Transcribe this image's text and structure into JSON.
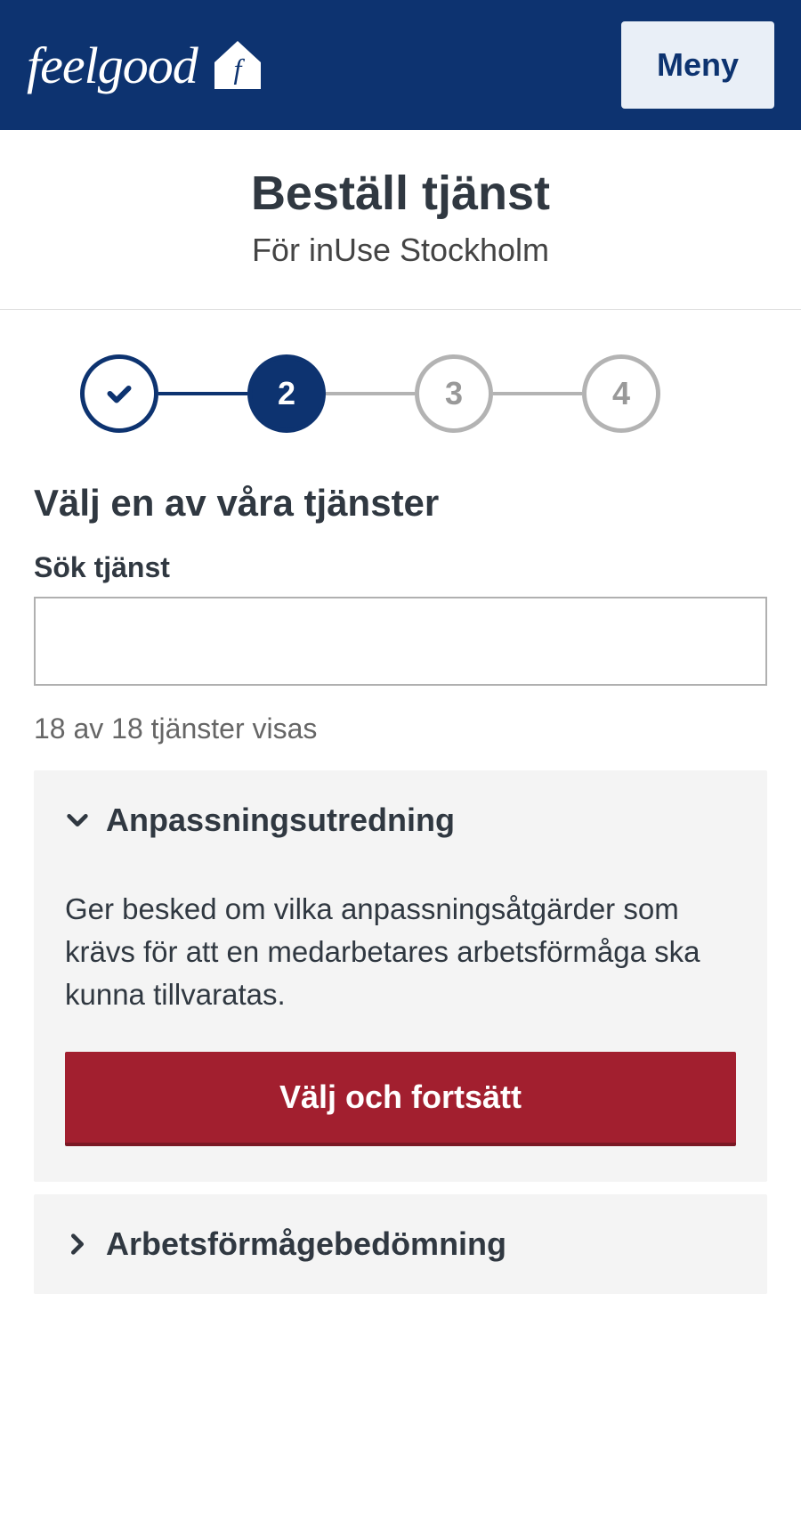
{
  "header": {
    "logo_text": "feelgood",
    "menu_label": "Meny"
  },
  "title": "Beställ tjänst",
  "subtitle": "För inUse Stockholm",
  "stepper": {
    "steps": [
      "check",
      "2",
      "3",
      "4"
    ],
    "current_index": 1
  },
  "section_heading": "Välj en av våra tjänster",
  "search": {
    "label": "Sök tjänst",
    "value": ""
  },
  "results_count_text": "18 av 18 tjänster visas",
  "services": [
    {
      "title": "Anpassningsutredning",
      "expanded": true,
      "description": "Ger besked om vilka anpassningsåtgärder som krävs för att en medarbetares arbetsförmåga ska kunna tillvaratas.",
      "action_label": "Välj och fortsätt"
    },
    {
      "title": "Arbetsförmågebedömning",
      "expanded": false
    }
  ],
  "colors": {
    "primary": "#0d3370",
    "action": "#a21f2f",
    "muted": "#b3b3b3"
  }
}
